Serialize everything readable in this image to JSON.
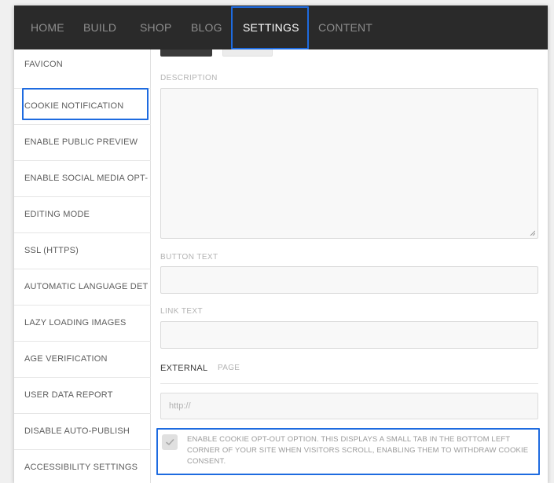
{
  "topnav": {
    "items": [
      {
        "label": "HOME"
      },
      {
        "label": "BUILD"
      },
      {
        "label": "SHOP"
      },
      {
        "label": "BLOG"
      },
      {
        "label": "SETTINGS"
      },
      {
        "label": "CONTENT"
      }
    ],
    "active": "SETTINGS"
  },
  "sidebar": {
    "items": [
      {
        "label": "FAVICON"
      },
      {
        "label": "COOKIE NOTIFICATION"
      },
      {
        "label": "ENABLE PUBLIC PREVIEW"
      },
      {
        "label": "ENABLE SOCIAL MEDIA OPT-"
      },
      {
        "label": "EDITING MODE"
      },
      {
        "label": "SSL (HTTPS)"
      },
      {
        "label": "AUTOMATIC LANGUAGE DET"
      },
      {
        "label": "LAZY LOADING IMAGES"
      },
      {
        "label": "AGE VERIFICATION"
      },
      {
        "label": "USER DATA REPORT"
      },
      {
        "label": "DISABLE AUTO-PUBLISH"
      },
      {
        "label": "ACCESSIBILITY SETTINGS"
      }
    ],
    "selected": "COOKIE NOTIFICATION"
  },
  "form": {
    "description_label": "DESCRIPTION",
    "description_value": "",
    "button_text_label": "BUTTON TEXT",
    "button_text_value": "",
    "link_text_label": "LINK TEXT",
    "link_text_value": "",
    "link_tabs": {
      "external": "EXTERNAL",
      "page": "PAGE",
      "active": "EXTERNAL"
    },
    "url_placeholder": "http://",
    "optout": {
      "checked": true,
      "text": "ENABLE COOKIE OPT-OUT OPTION. THIS DISPLAYS A SMALL TAB IN THE BOTTOM LEFT CORNER OF YOUR SITE WHEN VISITORS SCROLL, ENABLING THEM TO WITHDRAW COOKIE CONSENT."
    }
  },
  "colors": {
    "topbar_bg": "#2a2a2a",
    "highlight": "#1e6be0",
    "checkmark": "#a8a8a8"
  }
}
